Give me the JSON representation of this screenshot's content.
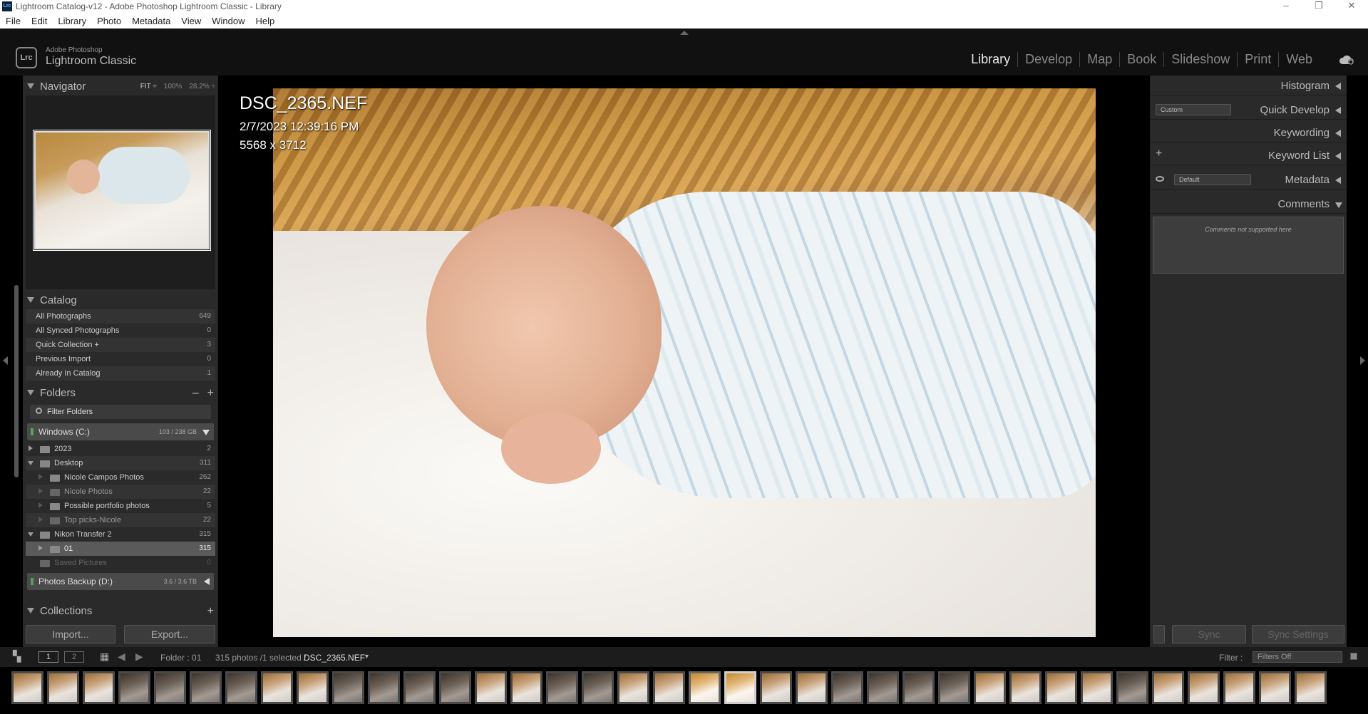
{
  "window": {
    "title": "Lightroom Catalog-v12 - Adobe Photoshop Lightroom Classic - Library",
    "app_icon": "Lrc",
    "controls": [
      "–",
      "❐",
      "✕"
    ]
  },
  "menu": [
    "File",
    "Edit",
    "Library",
    "Photo",
    "Metadata",
    "View",
    "Window",
    "Help"
  ],
  "brand": {
    "badge": "Lrc",
    "small": "Adobe Photoshop",
    "big": "Lightroom Classic"
  },
  "modules": [
    "Library",
    "Develop",
    "Map",
    "Book",
    "Slideshow",
    "Print",
    "Web"
  ],
  "active_module": "Library",
  "navigator": {
    "title": "Navigator",
    "options": [
      "FIT ÷",
      "100%",
      "28.2% ÷"
    ]
  },
  "catalog": {
    "title": "Catalog",
    "items": [
      {
        "name": "All Photographs",
        "count": "649"
      },
      {
        "name": "All Synced Photographs",
        "count": "0"
      },
      {
        "name": "Quick Collection +",
        "count": "3"
      },
      {
        "name": "Previous Import",
        "count": "0"
      },
      {
        "name": "Already In Catalog",
        "count": "1"
      }
    ]
  },
  "folders": {
    "title": "Folders",
    "actions": [
      "–",
      "+"
    ],
    "filter_label": "Filter Folders",
    "volume_c": {
      "name": "Windows (C:)",
      "size": "103 / 238 GB"
    },
    "items": [
      {
        "name": "2023",
        "count": "2"
      },
      {
        "name": "Desktop",
        "count": "311"
      },
      {
        "name": "Nicole Campos Photos",
        "count": "262"
      },
      {
        "name": "Nicole Photos",
        "count": "22"
      },
      {
        "name": "Possible portfolio photos",
        "count": "5"
      },
      {
        "name": "Top picks-Nicole",
        "count": "22"
      },
      {
        "name": "Nikon Transfer 2",
        "count": "315"
      },
      {
        "name": "01",
        "count": "315"
      },
      {
        "name": "Saved Pictures",
        "count": "0"
      }
    ],
    "volume_d": {
      "name": "Photos Backup (D:)",
      "size": "3.6 / 3.6 TB"
    }
  },
  "collections": {
    "title": "Collections",
    "action": "+"
  },
  "buttons": {
    "import": "Import...",
    "export": "Export..."
  },
  "photo_info": {
    "filename": "DSC_2365.NEF",
    "datetime": "2/7/2023 12:39:16 PM",
    "dimensions": "5568 x 3712"
  },
  "right_panels": {
    "histogram": "Histogram",
    "quick_develop": "Quick Develop",
    "quick_develop_preset": "Custom",
    "keywording": "Keywording",
    "keyword_list": "Keyword List",
    "keyword_add": "+",
    "metadata": "Metadata",
    "metadata_preset": "Default",
    "comments": "Comments",
    "comments_note": "Comments not supported here",
    "sync": "Sync",
    "sync_settings": "Sync Settings"
  },
  "filmstrip": {
    "view1": "1",
    "view2": "2",
    "folder_label": "Folder : 01",
    "count_label": "315 photos /1 selected /",
    "current_file": "DSC_2365.NEF",
    "filter_label": "Filter :",
    "filter_value": "Filters Off"
  }
}
